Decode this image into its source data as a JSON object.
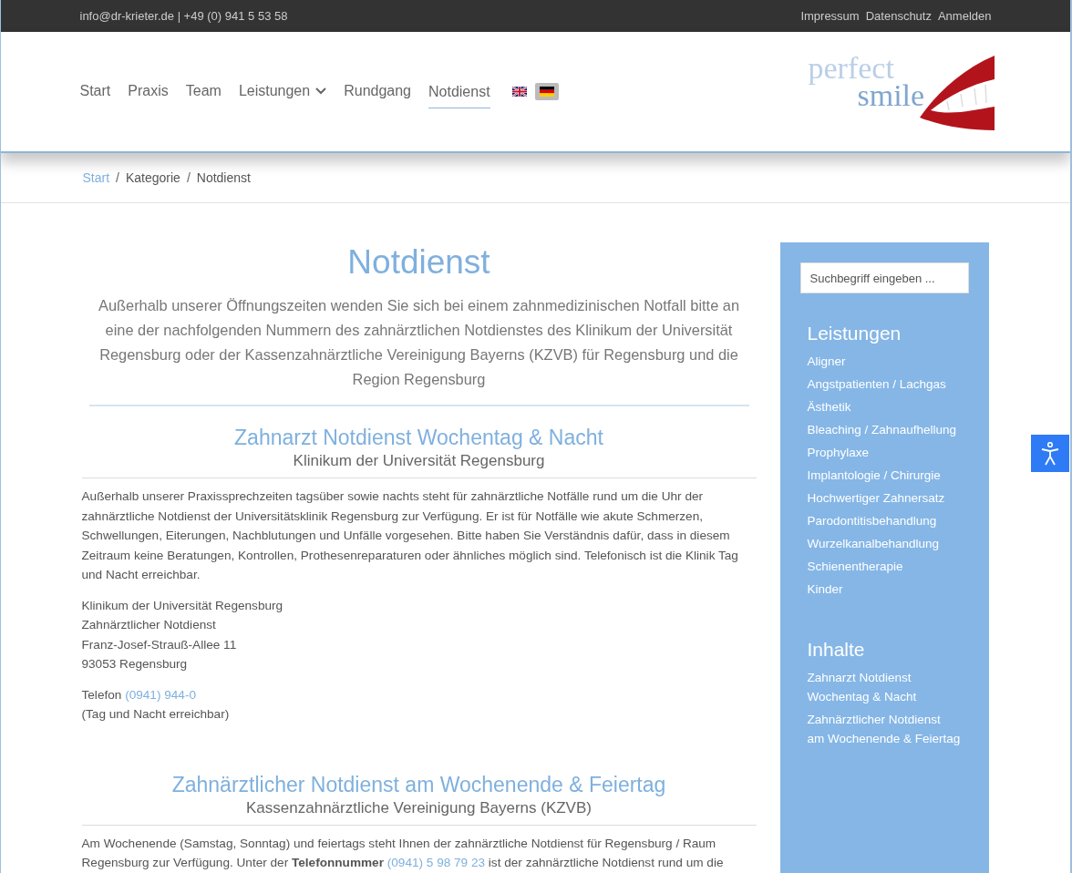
{
  "top_bar": {
    "contact": "info@dr-krieter.de | +49 (0) 941 5 53 58",
    "links": [
      "Impressum",
      "Datenschutz",
      "Anmelden"
    ]
  },
  "header": {
    "nav": [
      {
        "label": "Start",
        "selected": false,
        "has_dropdown": false
      },
      {
        "label": "Praxis",
        "selected": false,
        "has_dropdown": false
      },
      {
        "label": "Team",
        "selected": false,
        "has_dropdown": false
      },
      {
        "label": "Leistungen",
        "selected": false,
        "has_dropdown": true
      },
      {
        "label": "Rundgang",
        "selected": false,
        "has_dropdown": false
      },
      {
        "label": "Notdienst",
        "selected": true,
        "has_dropdown": false
      }
    ],
    "languages": [
      {
        "kind": "uk",
        "selected": false
      },
      {
        "kind": "de",
        "selected": true
      }
    ],
    "logo": {
      "line_1": "perfect",
      "line_2": "smile"
    }
  },
  "breadcrumb_separator": "/",
  "breadcrumb": [
    {
      "label": "Start",
      "kind": "link"
    },
    {
      "label": "Kategorie",
      "kind": "text"
    },
    {
      "label": "Notdienst",
      "kind": "text"
    }
  ],
  "content": {
    "title": "Notdienst",
    "intro": "Außerhalb unserer Öffnungszeiten wenden Sie sich bei einem zahnmedizinischen Notfall bitte an eine der nachfolgenden Nummern des zahnärztlichen Notdienstes des Klinikum der Universität Regensburg oder der Kassenzahnärztliche Vereinigung Bayerns (KZVB) für Regensburg und die Region Regensburg",
    "sections": [
      {
        "title": "Zahnarzt Notdienst Wochentag & Nacht",
        "subtitle": "Klinikum der Universität Regensburg",
        "blocks": [
          {
            "kind": "paragraph",
            "text": "Außerhalb unserer Praxissprechzeiten tagsüber sowie nachts steht für zahnärztliche Notfälle rund um die Uhr der zahnärztliche Notdienst der Universitätsklinik Regensburg zur Verfügung. Er ist für Notfälle wie akute Schmerzen, Schwellungen, Eiterungen, Nachblutungen und Unfälle vorgesehen. Bitte haben Sie Verständnis dafür, dass in diesem Zeitraum keine Beratungen, Kontrollen, Prothesenreparaturen oder ähnliches möglich sind. Telefonisch ist die Klinik Tag und Nacht erreichbar."
          },
          {
            "kind": "address",
            "lines": [
              "Klinikum der Universität Regensburg",
              "Zahnärztlicher Notdienst",
              "Franz-Josef-Strauß-Allee 11",
              "93053 Regensburg"
            ]
          },
          {
            "kind": "phone",
            "label": "Telefon",
            "number": "(0941) 944-0",
            "note": "(Tag und Nacht erreichbar)"
          }
        ]
      },
      {
        "title": "Zahnärztlicher Notdienst am Wochenende & Feiertag",
        "subtitle": "Kassenzahnärztliche Vereinigung Bayerns (KZVB)",
        "blocks": [
          {
            "kind": "linked_paragraph",
            "before": "Am Wochenende (Samstag, Sonntag) und feiertags steht Ihnen der zahnärztliche Notdienst für Regensburg / Raum Regensburg zur Verfügung. Unter der **Telefonnummer**",
            "link": "(0941) 5 98 79 23",
            "after": "ist der zahnärztliche Notdienst rund um die"
          }
        ]
      }
    ]
  },
  "sidebar": {
    "search": {
      "placeholder": "Suchbegriff eingeben ..."
    },
    "groups": [
      {
        "title": "Leistungen",
        "items": [
          "Aligner",
          "Angstpatienten / Lachgas",
          "Ästhetik",
          "Bleaching / Zahnaufhellung",
          "Prophylaxe",
          "Implantologie / Chirurgie",
          "Hochwertiger Zahnersatz",
          "Parodontitisbehandlung",
          "Wurzelkanalbehandlung",
          "Schienentherapie",
          "Kinder"
        ]
      },
      {
        "title": "Inhalte",
        "items": [
          "Zahnarzt Notdienst Wochentag & Nacht",
          "Zahnärztlicher Notdienst am Wochenende & Feiertag"
        ]
      }
    ]
  }
}
